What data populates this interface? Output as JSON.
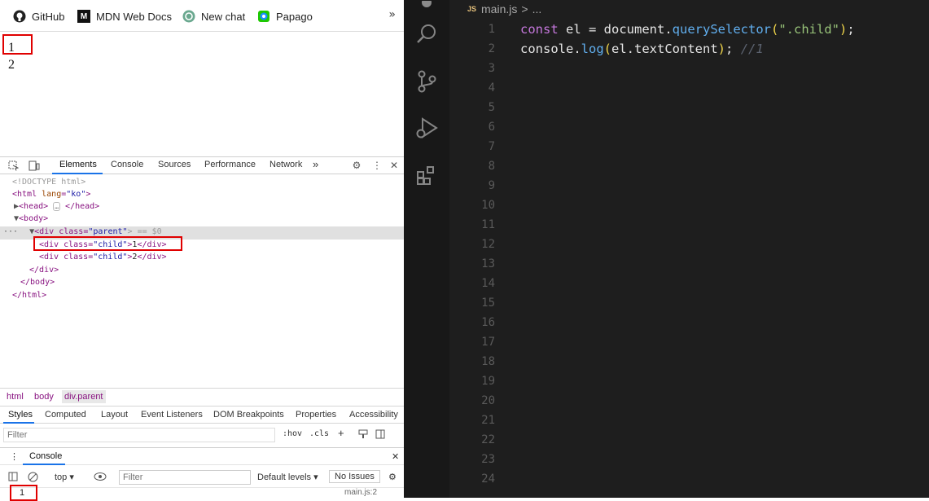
{
  "bookmarks": [
    {
      "label": "GitHub",
      "icon": "github-icon"
    },
    {
      "label": "MDN Web Docs",
      "icon": "mdn-icon"
    },
    {
      "label": "New chat",
      "icon": "openai-icon"
    },
    {
      "label": "Papago",
      "icon": "papago-icon"
    }
  ],
  "bookmarks_more": "»",
  "page": {
    "lines": [
      "1",
      "2"
    ]
  },
  "devtools": {
    "tabs": [
      "Elements",
      "Console",
      "Sources",
      "Performance",
      "Network"
    ],
    "more": "»",
    "dom": {
      "doctype": "<!DOCTYPE html>",
      "html_open_tag": "<html",
      "html_lang_attr": "lang",
      "html_lang_val": "\"ko\"",
      "head_line": "<head>",
      "head_close": "</head>",
      "body_open": "<body>",
      "parent_open": "<div class=",
      "parent_class": "\"parent\"",
      "parent_eq": "> == $0",
      "child1_open": "<div class=",
      "child1_class": "\"child\"",
      "child1_text": "1",
      "child_close": "</div>",
      "child2_open": "<div class=",
      "child2_class": "\"child\"",
      "child2_text": "2",
      "div_close": "</div>",
      "body_close": "</body>",
      "html_close": "</html>",
      "ellipsis": "…"
    },
    "breadcrumbs": [
      "html",
      "body",
      "div.parent"
    ],
    "style_tabs": [
      "Styles",
      "Computed",
      "Layout",
      "Event Listeners",
      "DOM Breakpoints",
      "Properties",
      "Accessibility"
    ],
    "filter_placeholder": "Filter",
    "hov": ":hov",
    "cls": ".cls",
    "console_title": "Console",
    "console_context": "top",
    "console_filter_placeholder": "Filter",
    "default_levels": "Default levels",
    "issues": "No Issues",
    "console_output": "1",
    "console_source": "main.js:2"
  },
  "vscode": {
    "breadcrumb_badge": "JS",
    "breadcrumb_file": "main.js",
    "breadcrumb_sep": ">",
    "breadcrumb_more": "...",
    "line_numbers": [
      "1",
      "2",
      "3",
      "4",
      "5",
      "6",
      "7",
      "8",
      "9",
      "10",
      "11",
      "12",
      "13",
      "14",
      "15",
      "16",
      "17",
      "18",
      "19",
      "20",
      "21",
      "22",
      "23",
      "24"
    ],
    "code": {
      "l1": {
        "kw": "const",
        "name": " el ",
        "eq": "= ",
        "obj": "document",
        "dot": ".",
        "fn": "querySelector",
        "po": "(",
        "str": "\".child\"",
        "pc": ")",
        "semi": ";"
      },
      "l2": {
        "obj": "console",
        "dot": ".",
        "fn": "log",
        "po": "(",
        "arg": "el.textContent",
        "pc": ")",
        "semi": "; ",
        "comment": "//1"
      }
    }
  },
  "colors": {
    "highlight_box": "#e00000",
    "vscode_bg": "#1e1e1e",
    "accent": "#1a73e8"
  }
}
